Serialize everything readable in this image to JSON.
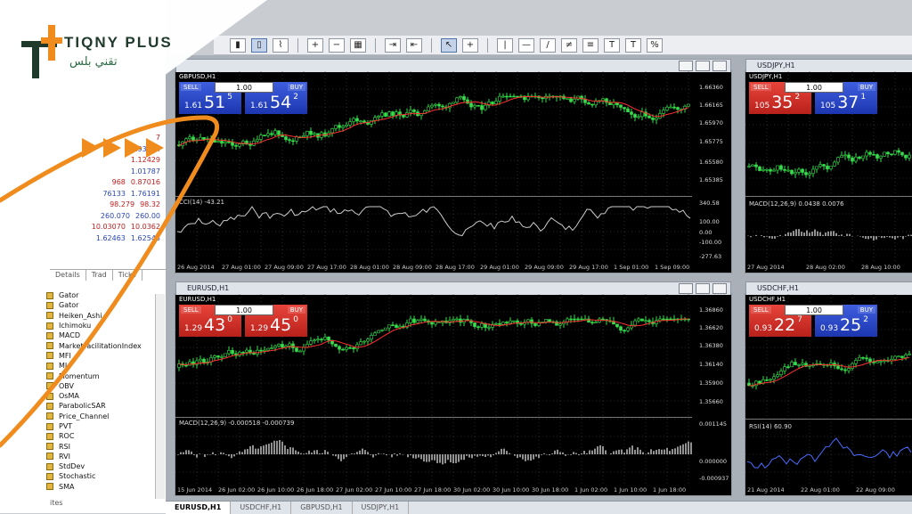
{
  "brand": {
    "name": "TIQNY PLUS",
    "arabic": "تقني بلس"
  },
  "market_watch": {
    "rows": [
      [
        "",
        "7"
      ],
      [
        "",
        "0.93514"
      ],
      [
        "",
        "1.12429"
      ],
      [
        "",
        "1.01787"
      ],
      [
        "968",
        "0.87016"
      ],
      [
        "76133",
        "1.76191"
      ],
      [
        "98.279",
        "98.32"
      ],
      [
        "260.070",
        "260.00"
      ],
      [
        "10.03070",
        "10.0362"
      ],
      [
        "1.62463",
        "1.62543"
      ]
    ],
    "tabs": [
      "Details",
      "Trad",
      "Ticks"
    ]
  },
  "navigator": {
    "items": [
      "Gator",
      "Gator",
      "Heiken_Ashi",
      "Ichimoku",
      "MACD",
      "MarketFacilitationIndex",
      "MFI",
      "MI",
      "Momentum",
      "OBV",
      "OsMA",
      "ParabolicSAR",
      "Price_Channel",
      "PVT",
      "ROC",
      "RSI",
      "RVI",
      "StdDev",
      "Stochastic",
      "SMA"
    ],
    "bottom_tab": "ites"
  },
  "windows": {
    "gbpusd": {
      "symbol": "GBPUSD,H1",
      "lot": "1.00",
      "sell_label": "SELL",
      "buy_label": "BUY",
      "bid_small": "1.61",
      "bid_big": "51",
      "bid_sup": "5",
      "ask_small": "1.61",
      "ask_big": "54",
      "ask_sup": "2",
      "ind_label": "CCI(14) -43.21",
      "price_axis": [
        "1.66360",
        "1.66165",
        "1.65970",
        "1.65775",
        "1.65580",
        "1.65385"
      ],
      "ind_axis": [
        "340.58",
        "100.00",
        "0.00",
        "-100.00",
        "-277.63"
      ],
      "time_axis": [
        "26 Aug 2014",
        "27 Aug 01:00",
        "27 Aug 09:00",
        "27 Aug 17:00",
        "28 Aug 01:00",
        "28 Aug 09:00",
        "28 Aug 17:00",
        "29 Aug 01:00",
        "29 Aug 09:00",
        "29 Aug 17:00",
        "1 Sep 01:00",
        "1 Sep 09:00"
      ]
    },
    "usdjpy": {
      "title": "USDJPY,H1",
      "symbol": "USDJPY,H1",
      "lot": "1.00",
      "sell_label": "SELL",
      "buy_label": "BUY",
      "bid_small": "105",
      "bid_big": "35",
      "bid_sup": "2",
      "ask_small": "105",
      "ask_big": "37",
      "ask_sup": "1",
      "ind_label": "MACD(12,26,9) 0.0438 0.0076",
      "time_axis": [
        "27 Aug 2014",
        "28 Aug 02:00",
        "28 Aug 10:00"
      ]
    },
    "eurusd": {
      "title": "EURUSD,H1",
      "symbol": "EURUSD,H1",
      "lot": "1.00",
      "sell_label": "SELL",
      "buy_label": "BUY",
      "bid_small": "1.29",
      "bid_big": "43",
      "bid_sup": "0",
      "ask_small": "1.29",
      "ask_big": "45",
      "ask_sup": "0",
      "ind_label": "MACD(12,26,9) -0.000518 -0.000739",
      "price_axis": [
        "1.36860",
        "1.36620",
        "1.36380",
        "1.36140",
        "1.35900",
        "1.35660"
      ],
      "ind_axis": [
        "0.001145",
        "0.000000",
        "-0.000937"
      ],
      "time_axis": [
        "15 Jun 2014",
        "26 Jun 02:00",
        "26 Jun 10:00",
        "26 Jun 18:00",
        "27 Jun 02:00",
        "27 Jun 10:00",
        "27 Jun 18:00",
        "30 Jun 02:00",
        "30 Jun 10:00",
        "30 Jun 18:00",
        "1 Jun 02:00",
        "1 Jun 10:00",
        "1 Jun 18:00"
      ]
    },
    "usdchf": {
      "title": "USDCHF,H1",
      "symbol": "USDCHF,H1",
      "lot": "1.00",
      "sell_label": "SELL",
      "buy_label": "BUY",
      "bid_small": "0.93",
      "bid_big": "22",
      "bid_sup": "7",
      "ask_small": "0.93",
      "ask_big": "25",
      "ask_sup": "2",
      "ind_label": "RSI(14) 60.90",
      "time_axis": [
        "21 Aug 2014",
        "22 Aug 01:00",
        "22 Aug 09:00"
      ]
    }
  },
  "bottom_tabs": [
    "EURUSD,H1",
    "USDCHF,H1",
    "GBPUSD,H1",
    "USDJPY,H1"
  ],
  "colors": {
    "accent_orange": "#f08c1e",
    "bull": "#35e04a",
    "sell": "#d12b22",
    "buy": "#2a45cc"
  }
}
